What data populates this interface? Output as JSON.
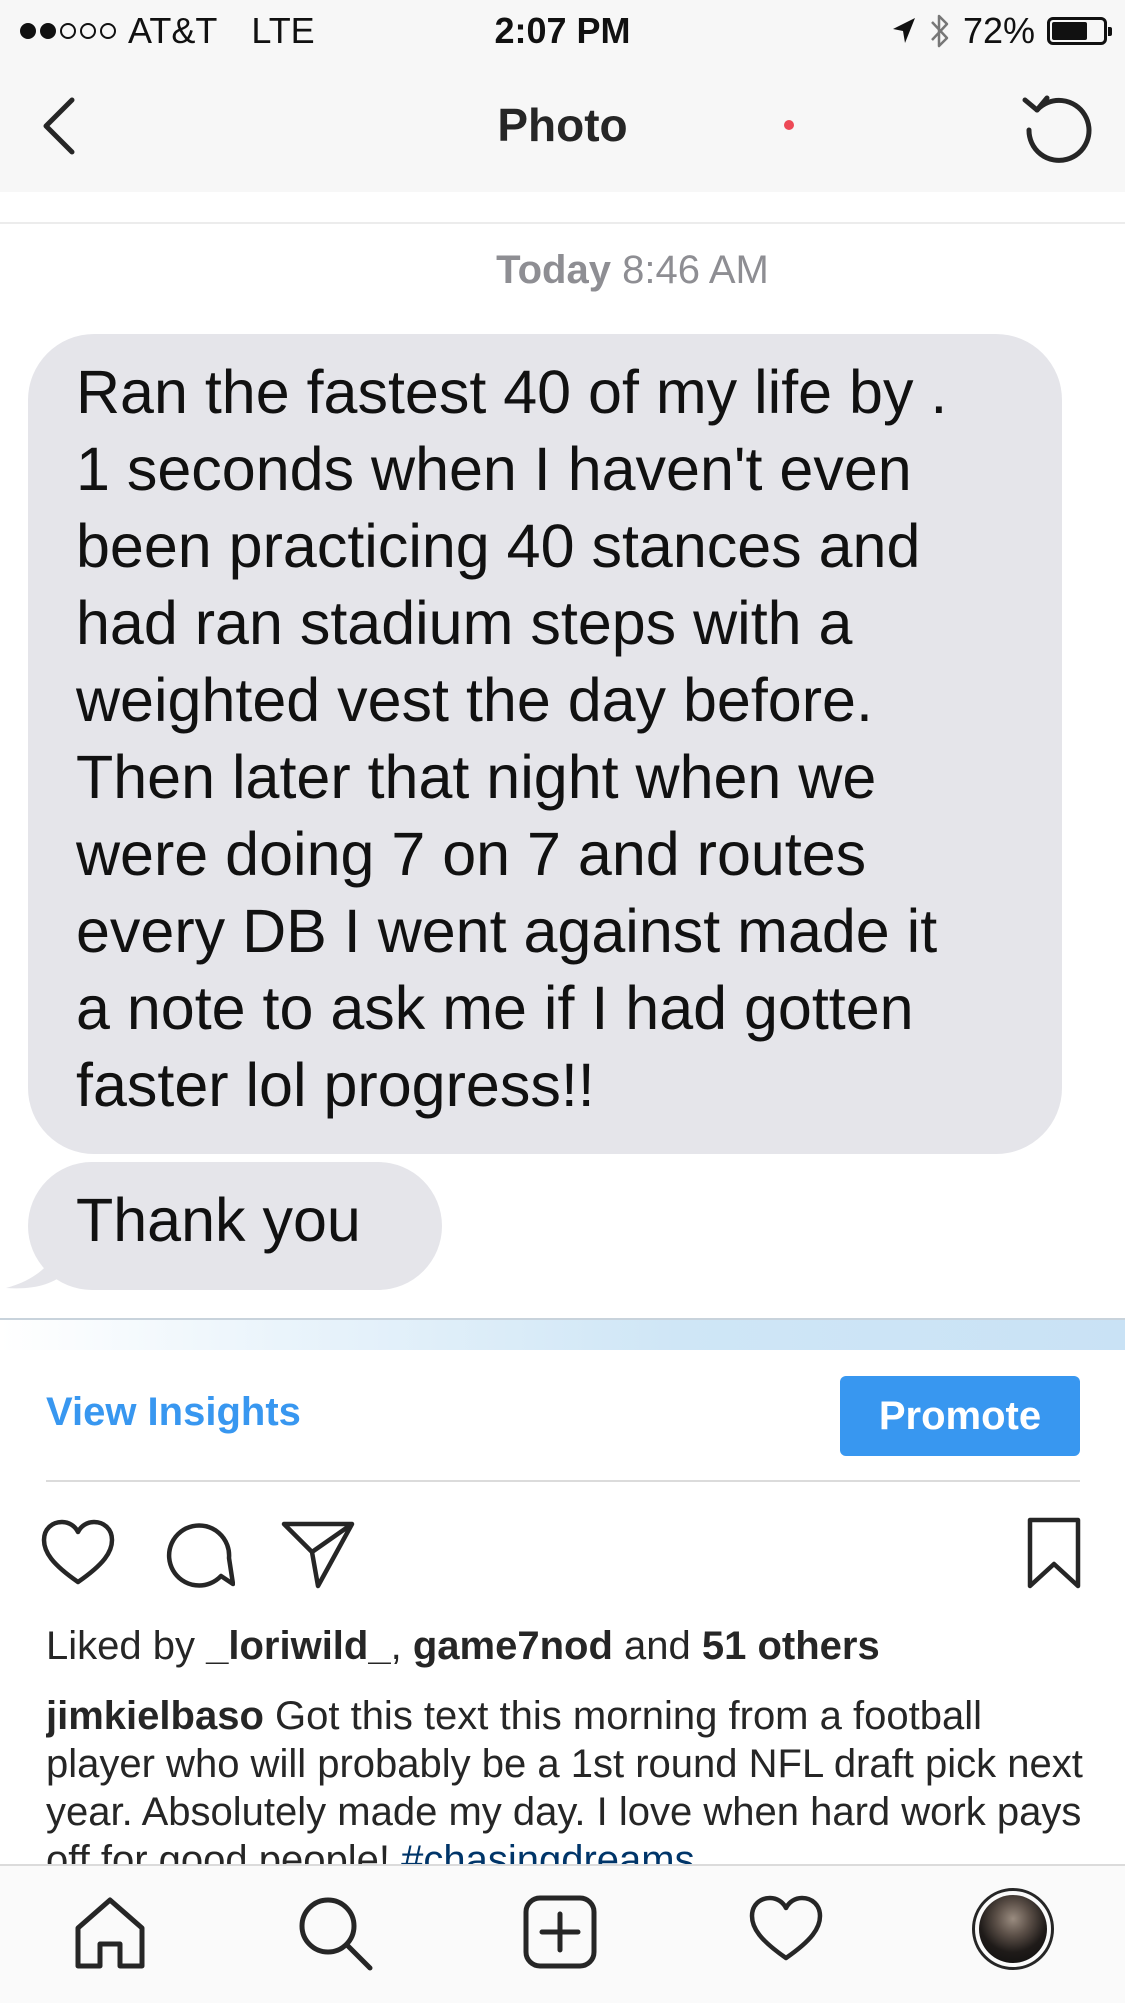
{
  "status_bar": {
    "carrier": "AT&T",
    "network": "LTE",
    "time": "2:07 PM",
    "battery": "72%",
    "battery_level": 0.72,
    "signal_bars_filled": 2,
    "signal_bars_total": 5,
    "icons": [
      "location-arrow-icon",
      "bluetooth-icon",
      "battery-icon"
    ]
  },
  "nav": {
    "title": "Photo",
    "back_icon": "chevron-left-icon",
    "refresh_icon": "refresh-icon"
  },
  "photo": {
    "timestamp_day": "Today",
    "timestamp_time": "8:46 AM",
    "message1_lines": [
      "Ran the fastest 40 of my life by .",
      "1 seconds when I haven't even",
      "been practicing 40 stances and",
      "had ran stadium steps with a",
      "weighted vest the day before.",
      "Then later that night when we",
      "were doing 7 on 7 and routes",
      "every DB I went against made it",
      "a note to ask me if I had gotten",
      "faster lol progress!!"
    ],
    "message2": "Thank you",
    "bubble_color": "#e5e5ea"
  },
  "post": {
    "view_insights": "View Insights",
    "promote": "Promote",
    "likes_prefix": "Liked by ",
    "liker1": "_loriwild_",
    "liker_sep": ", ",
    "liker2": "game7nod",
    "likes_and": " and ",
    "others": "51 others",
    "caption_user": "jimkielbaso",
    "caption_text": " Got this text this morning from a football player who will probably be a 1st round NFL draft pick next year. Absolutely made my day. I love when hard work pays off for good people! ",
    "caption_hashtag": "#chasingdreams",
    "accent_color": "#3897f0"
  },
  "tabbar": {
    "items": [
      "home-icon",
      "search-icon",
      "add-post-icon",
      "activity-heart-icon",
      "profile-avatar"
    ],
    "notification_dot_color": "#ed4956"
  }
}
